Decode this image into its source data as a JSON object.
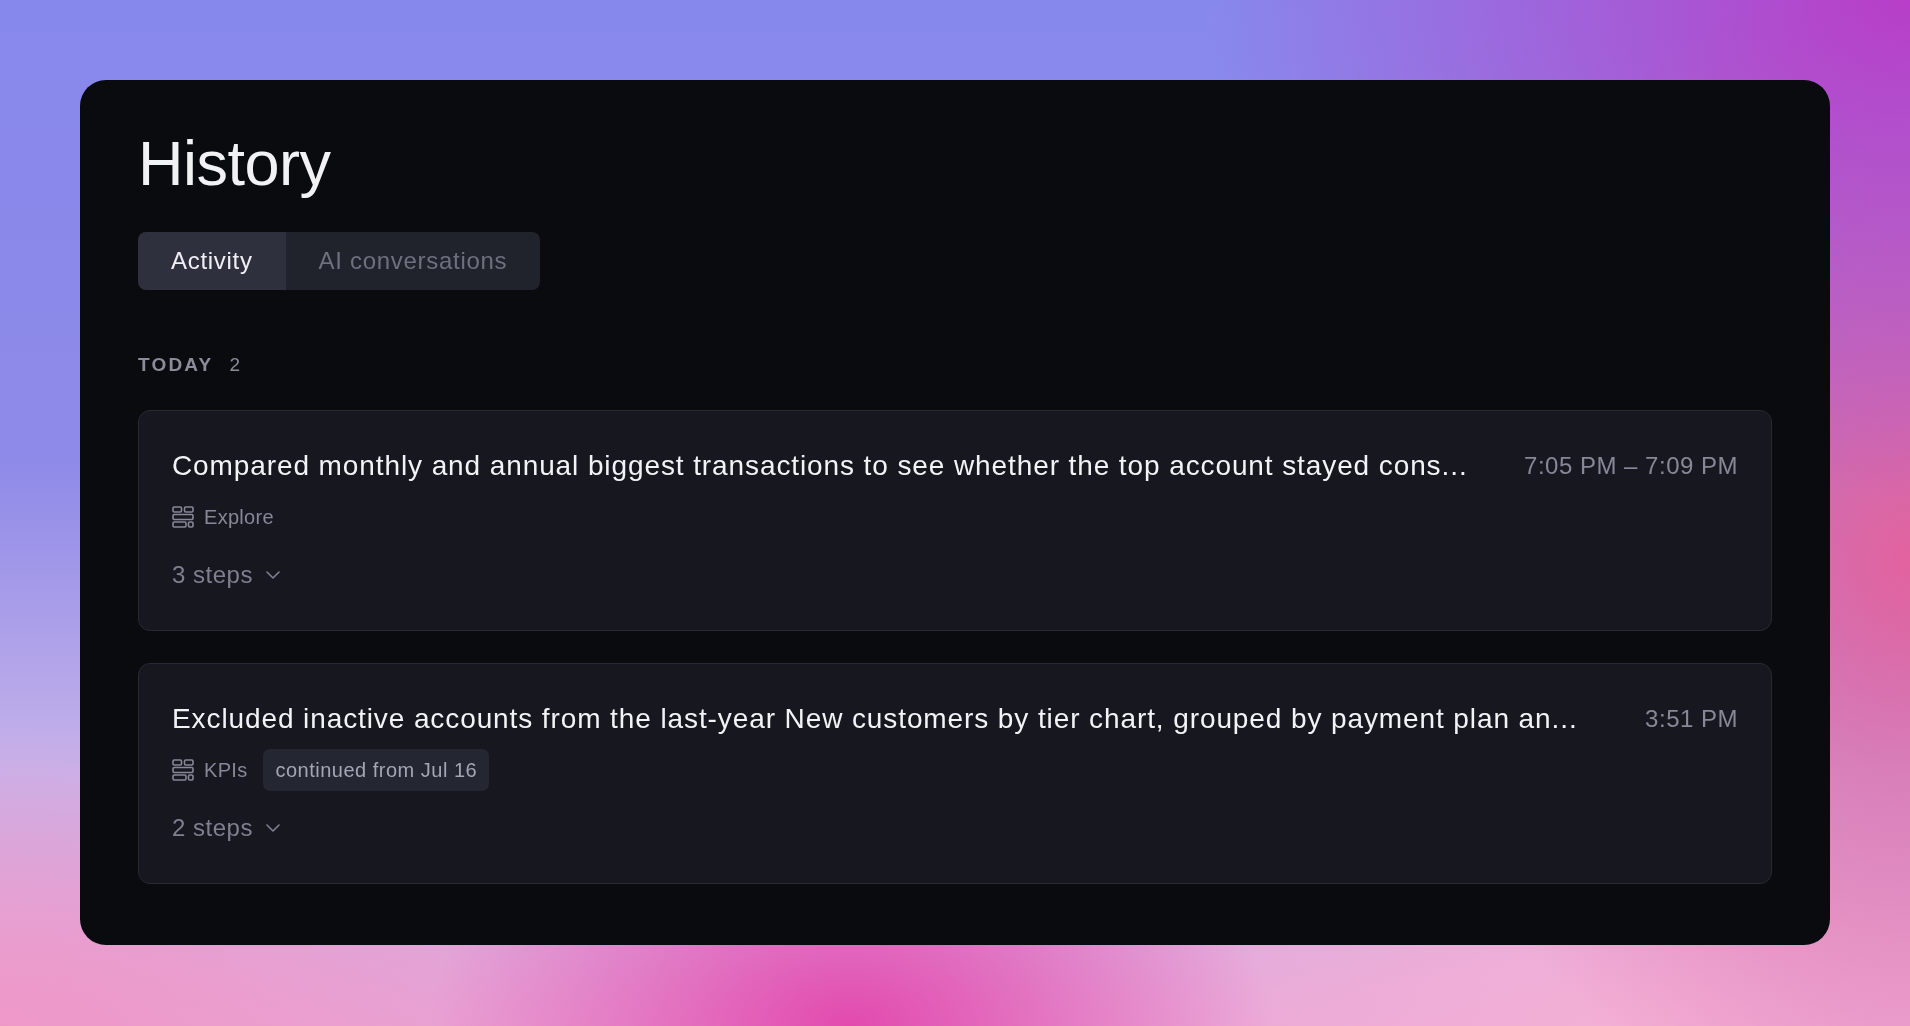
{
  "title": "History",
  "tabs": [
    {
      "label": "Activity",
      "selected": true
    },
    {
      "label": "AI conversations",
      "selected": false
    }
  ],
  "sections": [
    {
      "label": "TODAY",
      "count": "2",
      "items": [
        {
          "title": "Compared monthly and annual biggest transactions to see whether the top account stayed cons...",
          "time": "7:05 PM – 7:09 PM",
          "source": "Explore",
          "steps": "3 steps"
        },
        {
          "title": "Excluded inactive accounts from the last-year New customers by tier chart, grouped by payment plan an...",
          "time": "3:51 PM",
          "source": "KPIs",
          "tag": "continued from Jul 16",
          "steps": "2 steps"
        }
      ]
    }
  ]
}
